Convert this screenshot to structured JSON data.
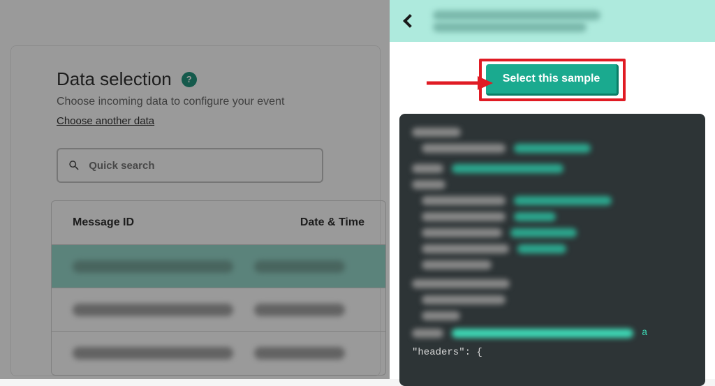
{
  "main": {
    "title": "Data selection",
    "subtitle": "Choose incoming data to configure your event",
    "choose_link": "Choose another data",
    "search_placeholder": "Quick search",
    "columns": {
      "id": "Message ID",
      "date": "Date & Time"
    }
  },
  "drawer": {
    "select_button": "Select this sample",
    "code_visible_text": "\"headers\": {"
  },
  "colors": {
    "accent": "#1aaa8f",
    "header_bg": "#aeeadd",
    "annotation": "#e01b24",
    "code_bg": "#2d3436"
  }
}
